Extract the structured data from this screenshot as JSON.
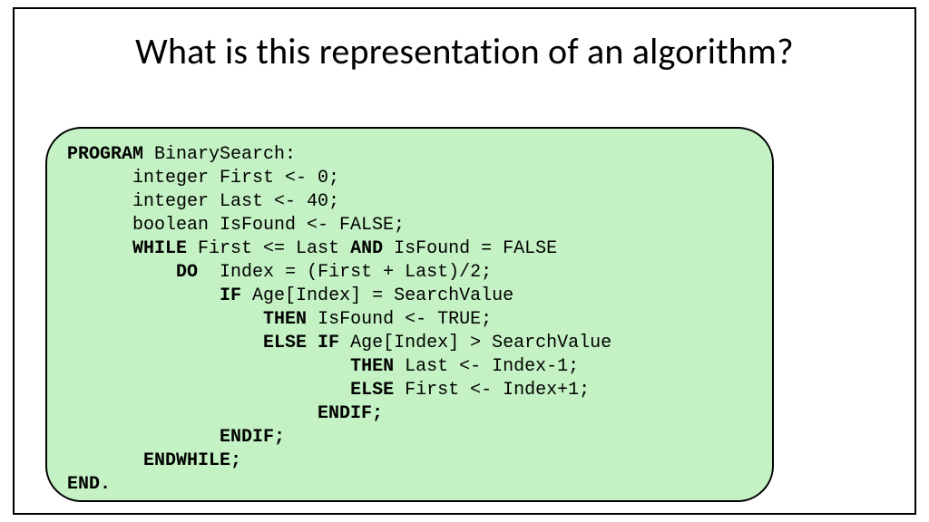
{
  "title": "What is this representation of an algorithm?",
  "code": {
    "l01a": "PROGRAM",
    "l01b": " BinarySearch:",
    "l02": "      integer First <- 0;",
    "l03": "      integer Last <- 40;",
    "l04": "      boolean IsFound <- FALSE;",
    "l05a": "      ",
    "l05b": "WHILE",
    "l05c": " First <= Last ",
    "l05d": "AND",
    "l05e": " IsFound = FALSE",
    "l06a": "          ",
    "l06b": "DO",
    "l06c": "  Index = (First + Last)/2;",
    "l07a": "              ",
    "l07b": "IF",
    "l07c": " Age[Index] = SearchValue",
    "l08a": "                  ",
    "l08b": "THEN",
    "l08c": " IsFound <- TRUE;",
    "l09a": "                  ",
    "l09b": "ELSE IF",
    "l09c": " Age[Index] > SearchValue",
    "l10a": "                          ",
    "l10b": "THEN",
    "l10c": " Last <- Index-1;",
    "l11a": "                          ",
    "l11b": "ELSE",
    "l11c": " First <- Index+1;",
    "l12a": "                       ",
    "l12b": "ENDIF;",
    "l13a": "              ",
    "l13b": "ENDIF;",
    "l14a": "       ",
    "l14b": "ENDWHILE;",
    "l15": "END."
  }
}
